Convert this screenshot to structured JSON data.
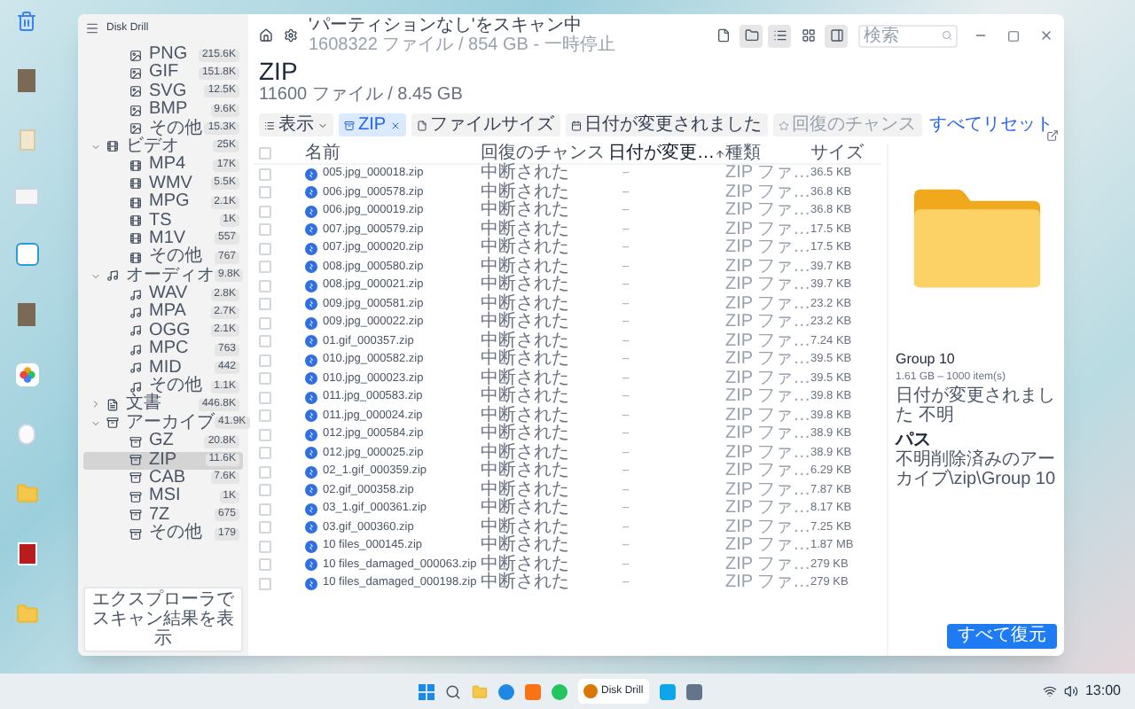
{
  "sidebar": {
    "app_title": "Disk Drill",
    "items": [
      {
        "kind": "image",
        "children": [
          {
            "label": "PNG",
            "count": "215.6K",
            "selected": false
          },
          {
            "label": "GIF",
            "count": "151.8K",
            "selected": false
          },
          {
            "label": "SVG",
            "count": "12.5K",
            "selected": false
          },
          {
            "label": "BMP",
            "count": "9.6K",
            "selected": false
          },
          {
            "label": "その他",
            "count": "15.3K",
            "selected": false
          }
        ]
      },
      {
        "kind": "video",
        "label": "ビデオ",
        "count": "25K",
        "expanded": true,
        "children": [
          {
            "label": "MP4",
            "count": "17K",
            "selected": false
          },
          {
            "label": "WMV",
            "count": "5.5K",
            "selected": false
          },
          {
            "label": "MPG",
            "count": "2.1K",
            "selected": false
          },
          {
            "label": "TS",
            "count": "1K",
            "selected": false
          },
          {
            "label": "M1V",
            "count": "557",
            "selected": false
          },
          {
            "label": "その他",
            "count": "767",
            "selected": false
          }
        ]
      },
      {
        "kind": "audio",
        "label": "オーディオ",
        "count": "9.8K",
        "expanded": true,
        "children": [
          {
            "label": "WAV",
            "count": "2.8K",
            "selected": false
          },
          {
            "label": "MPA",
            "count": "2.7K",
            "selected": false
          },
          {
            "label": "OGG",
            "count": "2.1K",
            "selected": false
          },
          {
            "label": "MPC",
            "count": "763",
            "selected": false
          },
          {
            "label": "MID",
            "count": "442",
            "selected": false
          },
          {
            "label": "その他",
            "count": "1.1K",
            "selected": false
          }
        ]
      },
      {
        "kind": "document",
        "label": "文書",
        "count": "446.8K",
        "expanded": false
      },
      {
        "kind": "archive",
        "label": "アーカイブ",
        "count": "41.9K",
        "expanded": true,
        "children": [
          {
            "label": "GZ",
            "count": "20.8K",
            "selected": false
          },
          {
            "label": "ZIP",
            "count": "11.6K",
            "selected": true
          },
          {
            "label": "CAB",
            "count": "7.6K",
            "selected": false
          },
          {
            "label": "MSI",
            "count": "1K",
            "selected": false
          },
          {
            "label": "7Z",
            "count": "675",
            "selected": false
          },
          {
            "label": "その他",
            "count": "179",
            "selected": false
          }
        ]
      }
    ],
    "footer_button": "エクスプローラでスキャン結果を表示"
  },
  "header": {
    "scan_title": "'パーティションなし'をスキャン中",
    "scan_status": "1608322 ファイル / 854 GB - 一時停止",
    "view_buttons": [
      {
        "kind": "file",
        "selected": false
      },
      {
        "kind": "folder",
        "selected": true
      },
      {
        "kind": "list",
        "selected": true
      },
      {
        "kind": "grid",
        "selected": false
      },
      {
        "kind": "preview",
        "selected": true
      }
    ],
    "search": {
      "placeholder": "検索"
    }
  },
  "category": {
    "title": "ZIP",
    "summary": "11600 ファイル / 8.45 GB"
  },
  "filters": [
    {
      "kind": "view",
      "label": "表示",
      "active": false,
      "disabled": false
    },
    {
      "kind": "type",
      "label": "ZIP",
      "active": true,
      "disabled": false
    },
    {
      "kind": "size",
      "label": "ファイルサイズ",
      "active": false,
      "disabled": false
    },
    {
      "kind": "date",
      "label": "日付が変更されました",
      "active": false,
      "disabled": false
    },
    {
      "kind": "chance",
      "label": "回復のチャンス",
      "active": false,
      "disabled": true
    }
  ],
  "reset_link": "すべてリセット",
  "table": {
    "all_checked": false,
    "columns": [
      {
        "label": "名前",
        "sorted": false
      },
      {
        "label": "回復のチャンス",
        "sorted": false
      },
      {
        "label": "日付が変更…",
        "sorted": true
      },
      {
        "label": "種類",
        "sorted": false
      },
      {
        "label": "サイズ",
        "sorted": false
      }
    ],
    "rows": [
      {
        "name": "005.jpg_000018.zip",
        "chance": "中断された",
        "date": "–",
        "type": "ZIP ファ…",
        "size": "36.5 KB",
        "checked": false
      },
      {
        "name": "006.jpg_000578.zip",
        "chance": "中断された",
        "date": "–",
        "type": "ZIP ファ…",
        "size": "36.8 KB",
        "checked": false
      },
      {
        "name": "006.jpg_000019.zip",
        "chance": "中断された",
        "date": "–",
        "type": "ZIP ファ…",
        "size": "36.8 KB",
        "checked": false
      },
      {
        "name": "007.jpg_000579.zip",
        "chance": "中断された",
        "date": "–",
        "type": "ZIP ファ…",
        "size": "17.5 KB",
        "checked": false
      },
      {
        "name": "007.jpg_000020.zip",
        "chance": "中断された",
        "date": "–",
        "type": "ZIP ファ…",
        "size": "17.5 KB",
        "checked": false
      },
      {
        "name": "008.jpg_000580.zip",
        "chance": "中断された",
        "date": "–",
        "type": "ZIP ファ…",
        "size": "39.7 KB",
        "checked": false
      },
      {
        "name": "008.jpg_000021.zip",
        "chance": "中断された",
        "date": "–",
        "type": "ZIP ファ…",
        "size": "39.7 KB",
        "checked": false
      },
      {
        "name": "009.jpg_000581.zip",
        "chance": "中断された",
        "date": "–",
        "type": "ZIP ファ…",
        "size": "23.2 KB",
        "checked": false
      },
      {
        "name": "009.jpg_000022.zip",
        "chance": "中断された",
        "date": "–",
        "type": "ZIP ファ…",
        "size": "23.2 KB",
        "checked": false
      },
      {
        "name": "01.gif_000357.zip",
        "chance": "中断された",
        "date": "–",
        "type": "ZIP ファ…",
        "size": "7.24 KB",
        "checked": false
      },
      {
        "name": "010.jpg_000582.zip",
        "chance": "中断された",
        "date": "–",
        "type": "ZIP ファ…",
        "size": "39.5 KB",
        "checked": false
      },
      {
        "name": "010.jpg_000023.zip",
        "chance": "中断された",
        "date": "–",
        "type": "ZIP ファ…",
        "size": "39.5 KB",
        "checked": false
      },
      {
        "name": "011.jpg_000583.zip",
        "chance": "中断された",
        "date": "–",
        "type": "ZIP ファ…",
        "size": "39.8 KB",
        "checked": false
      },
      {
        "name": "011.jpg_000024.zip",
        "chance": "中断された",
        "date": "–",
        "type": "ZIP ファ…",
        "size": "39.8 KB",
        "checked": false
      },
      {
        "name": "012.jpg_000584.zip",
        "chance": "中断された",
        "date": "–",
        "type": "ZIP ファ…",
        "size": "38.9 KB",
        "checked": false
      },
      {
        "name": "012.jpg_000025.zip",
        "chance": "中断された",
        "date": "–",
        "type": "ZIP ファ…",
        "size": "38.9 KB",
        "checked": false
      },
      {
        "name": "02_1.gif_000359.zip",
        "chance": "中断された",
        "date": "–",
        "type": "ZIP ファ…",
        "size": "6.29 KB",
        "checked": false
      },
      {
        "name": "02.gif_000358.zip",
        "chance": "中断された",
        "date": "–",
        "type": "ZIP ファ…",
        "size": "7.87 KB",
        "checked": false
      },
      {
        "name": "03_1.gif_000361.zip",
        "chance": "中断された",
        "date": "–",
        "type": "ZIP ファ…",
        "size": "8.17 KB",
        "checked": false
      },
      {
        "name": "03.gif_000360.zip",
        "chance": "中断された",
        "date": "–",
        "type": "ZIP ファ…",
        "size": "7.25 KB",
        "checked": false
      },
      {
        "name": "10 files_000145.zip",
        "chance": "中断された",
        "date": "–",
        "type": "ZIP ファ…",
        "size": "1.87 MB",
        "checked": false
      },
      {
        "name": "10 files_damaged_000063.zip",
        "chance": "中断された",
        "date": "–",
        "type": "ZIP ファ…",
        "size": "279 KB",
        "checked": false
      },
      {
        "name": "10 files_damaged_000198.zip",
        "chance": "中断された",
        "date": "–",
        "type": "ZIP ファ…",
        "size": "279 KB",
        "checked": false
      }
    ]
  },
  "preview": {
    "title": "Group 10",
    "details": "1.61 GB – 1000 item(s)",
    "date_line": "日付が変更されました 不明",
    "path_label": "パス",
    "path": "不明削除済みのアーカイブ\\zip\\Group 10"
  },
  "restore_button": "すべて復元",
  "taskbar": {
    "active_app": "Disk Drill",
    "time": "13:00"
  }
}
